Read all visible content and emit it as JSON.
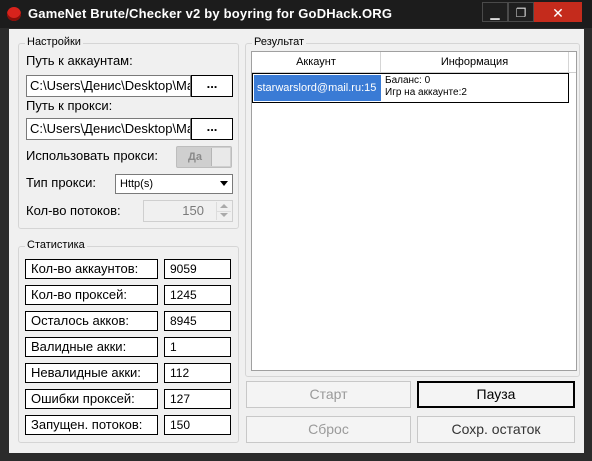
{
  "window": {
    "title": "GameNet Brute/Checker v2  by  boyring  for  GoDHack.ORG",
    "min_glyph": "▁",
    "max_glyph": "❐",
    "close_glyph": "✕"
  },
  "settings": {
    "group_title": "Настройки",
    "accounts_path_label": "Путь к аккаунтам:",
    "accounts_path_value": "C:\\Users\\Денис\\Desktop\\Mail.txt",
    "proxy_path_label": "Путь к прокси:",
    "proxy_path_value": "C:\\Users\\Денис\\Desktop\\Mail.txt",
    "browse_label": "...",
    "use_proxy_label": "Использовать прокси:",
    "use_proxy_toggle": "Да",
    "proxy_type_label": "Тип прокси:",
    "proxy_type_value": "Http(s)",
    "threads_label": "Кол-во потоков:",
    "threads_value": "150"
  },
  "stats": {
    "group_title": "Статистика",
    "rows": [
      {
        "label": "Кол-во аккаунтов:",
        "value": "9059"
      },
      {
        "label": "Кол-во проксей:",
        "value": "1245"
      },
      {
        "label": "Осталось акков:",
        "value": "8945"
      },
      {
        "label": "Валидные акки:",
        "value": "1"
      },
      {
        "label": "Невалидные акки:",
        "value": "112"
      },
      {
        "label": "Ошибки проксей:",
        "value": "127"
      },
      {
        "label": "Запущен. потоков:",
        "value": "150"
      }
    ]
  },
  "results": {
    "group_title": "Результат",
    "columns": [
      "Аккаунт",
      "Информация"
    ],
    "rows": [
      {
        "account": "starwarslord@mail.ru:15",
        "info_line1": "Баланс: 0",
        "info_line2": "Игр на аккаунте:2"
      }
    ]
  },
  "buttons": {
    "start": "Старт",
    "pause": "Пауза",
    "reset": "Сброс",
    "save_rest": "Сохр. остаток"
  }
}
